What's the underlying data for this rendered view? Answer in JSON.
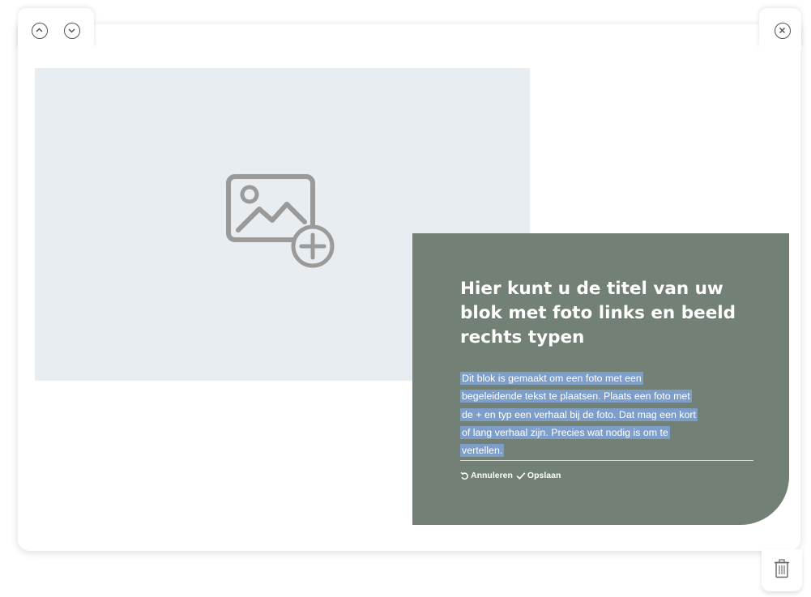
{
  "editor": {
    "move_up_icon": "chevron-up-circle-icon",
    "move_down_icon": "chevron-down-circle-icon",
    "close_icon": "close-circle-icon",
    "delete_icon": "trash-icon"
  },
  "image_block": {
    "icon": "image-add-icon",
    "background_color": "#e8edf1"
  },
  "text_block": {
    "background_color": "#738076",
    "title": "Hier kunt u de titel van uw blok met foto links en beeld rechts typen",
    "body_lines": [
      "Dit blok is gemaakt om een foto met een",
      "begeleidende tekst te plaatsen. Plaats een foto met",
      "de + en typ een verhaal bij de foto. Dat mag een kort",
      "of lang verhaal zijn. Precies wat nodig is om te",
      "vertellen."
    ],
    "cancel_label": "Annuleren",
    "save_label": "Opslaan"
  },
  "colors": {
    "selection": "#7d9ec9",
    "icon_gray": "#9a9a9a"
  }
}
